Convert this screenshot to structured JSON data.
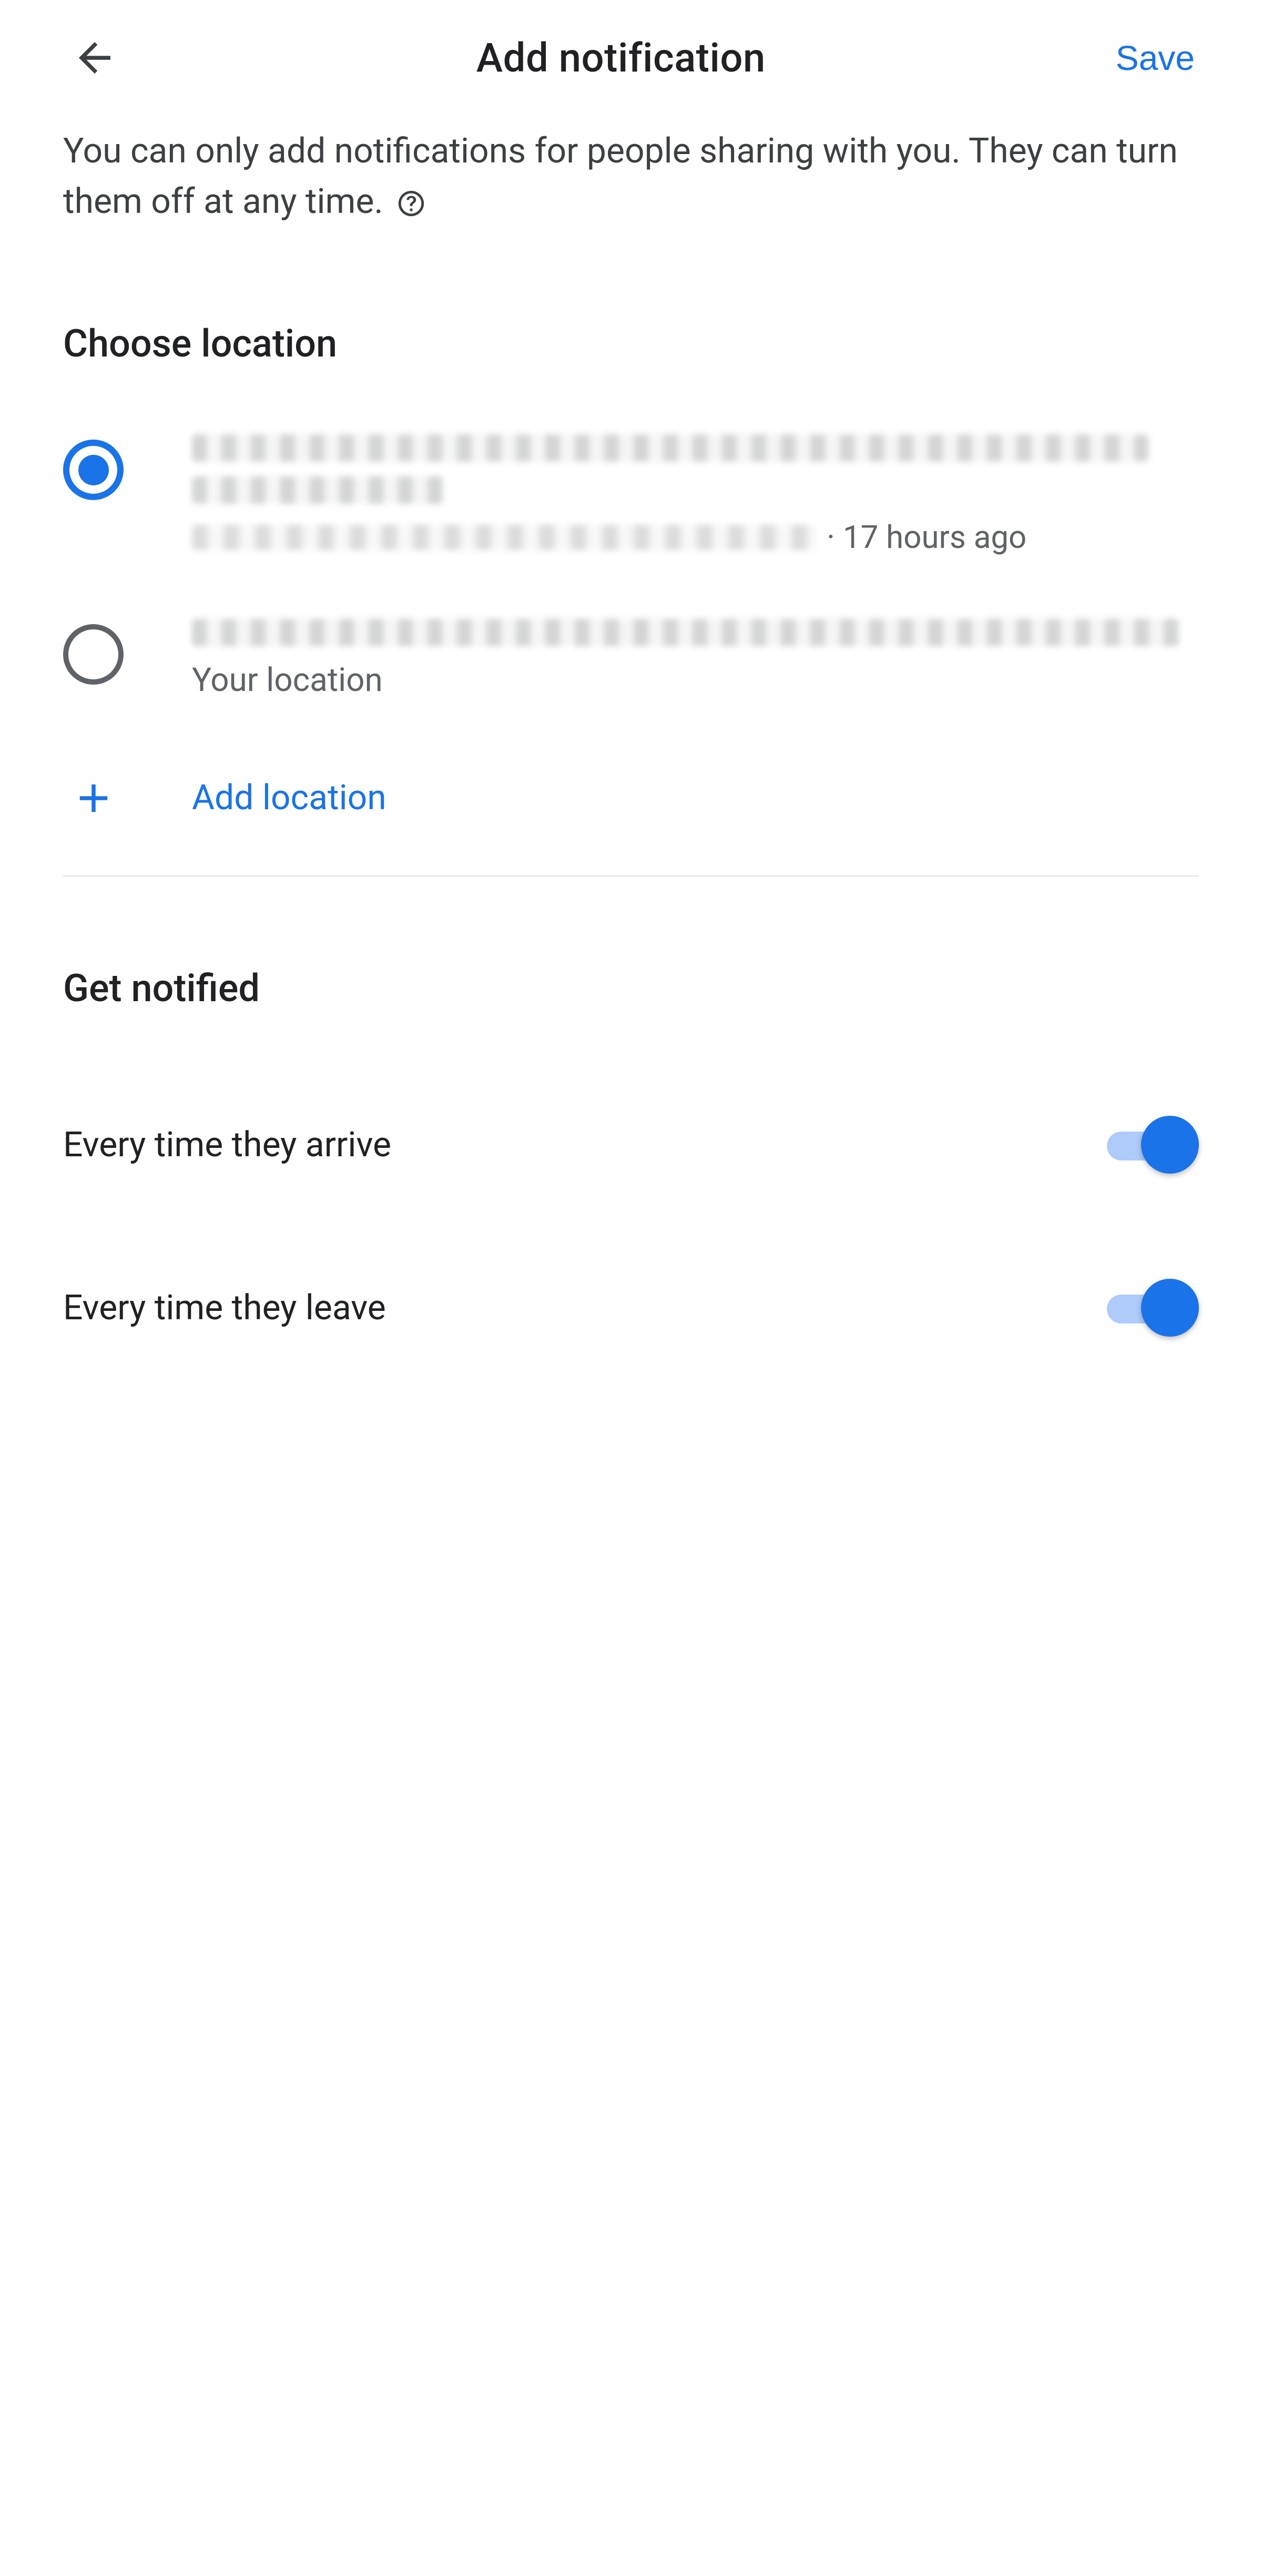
{
  "header": {
    "title": "Add notification",
    "save_label": "Save"
  },
  "description": {
    "text": "You can only add notifications for people sharing with you. They can turn them off at any time."
  },
  "choose_location": {
    "title": "Choose location",
    "options": [
      {
        "selected": true,
        "timestamp_prefix": " · ",
        "timestamp": "17 hours ago"
      },
      {
        "selected": false,
        "subtitle": "Your location"
      }
    ],
    "add_label": "Add location"
  },
  "get_notified": {
    "title": "Get notified",
    "toggles": [
      {
        "label": "Every time they arrive",
        "on": true
      },
      {
        "label": "Every time they leave",
        "on": true
      }
    ]
  },
  "colors": {
    "accent": "#1a73e8",
    "text_primary": "#202124",
    "text_secondary": "#5f6368",
    "track": "#aecbfa"
  }
}
